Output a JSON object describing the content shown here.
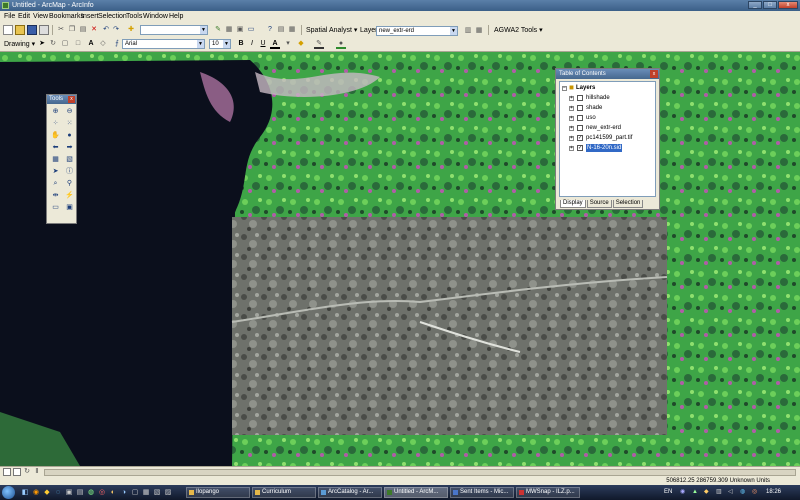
{
  "window": {
    "title": "Untitled - ArcMap - ArcInfo",
    "buttons": {
      "minimize": "_",
      "maximize": "□",
      "close": "x"
    }
  },
  "menu": [
    "File",
    "Edit",
    "View",
    "Bookmarks",
    "Insert",
    "Selection",
    "Tools",
    "Window",
    "Help"
  ],
  "toolbar1": {
    "scale_value": "",
    "spatial_analyst_label": "Spatial Analyst ▾",
    "layer_label": "Layer:",
    "layer_value": "new_extr-erd",
    "agwa_label": "AGWA2 Tools ▾"
  },
  "toolbar2": {
    "drawing_label": "Drawing ▾",
    "font_value": "Arial",
    "font_size_value": "10",
    "bold": "B",
    "italic": "I",
    "underline": "U",
    "font_color_glyph": "A"
  },
  "tools_window": {
    "title": "Tools",
    "close": "x"
  },
  "toc": {
    "title": "Table of Contents",
    "close": "x",
    "root": "Layers",
    "layers": [
      {
        "name": "hillshade",
        "checked": false
      },
      {
        "name": "shade",
        "checked": false
      },
      {
        "name": "uso",
        "checked": false
      },
      {
        "name": "new_extr-erd",
        "checked": false
      },
      {
        "name": "pc141599_part.tif",
        "checked": true
      },
      {
        "name": "N-16-20n.sid",
        "checked": true,
        "selected": true
      }
    ],
    "tabs": [
      "Display",
      "Source",
      "Selection"
    ]
  },
  "status": {
    "coordinates": "506812.25 286759.309 Unknown Units"
  },
  "taskbar": {
    "items": [
      "Ilopango",
      "Curriculum",
      "ArcCatalog - Ar...",
      "Untitled - ArcM...",
      "Sent Items - Mic...",
      "MWSnap - ILZ.p..."
    ],
    "lang": "EN",
    "time": "18:26"
  },
  "colors": {
    "water": "#0b0f1c",
    "vegetation": "#3fae47",
    "gray_scene": "#7c7f7a",
    "selection": "#3169c6"
  }
}
